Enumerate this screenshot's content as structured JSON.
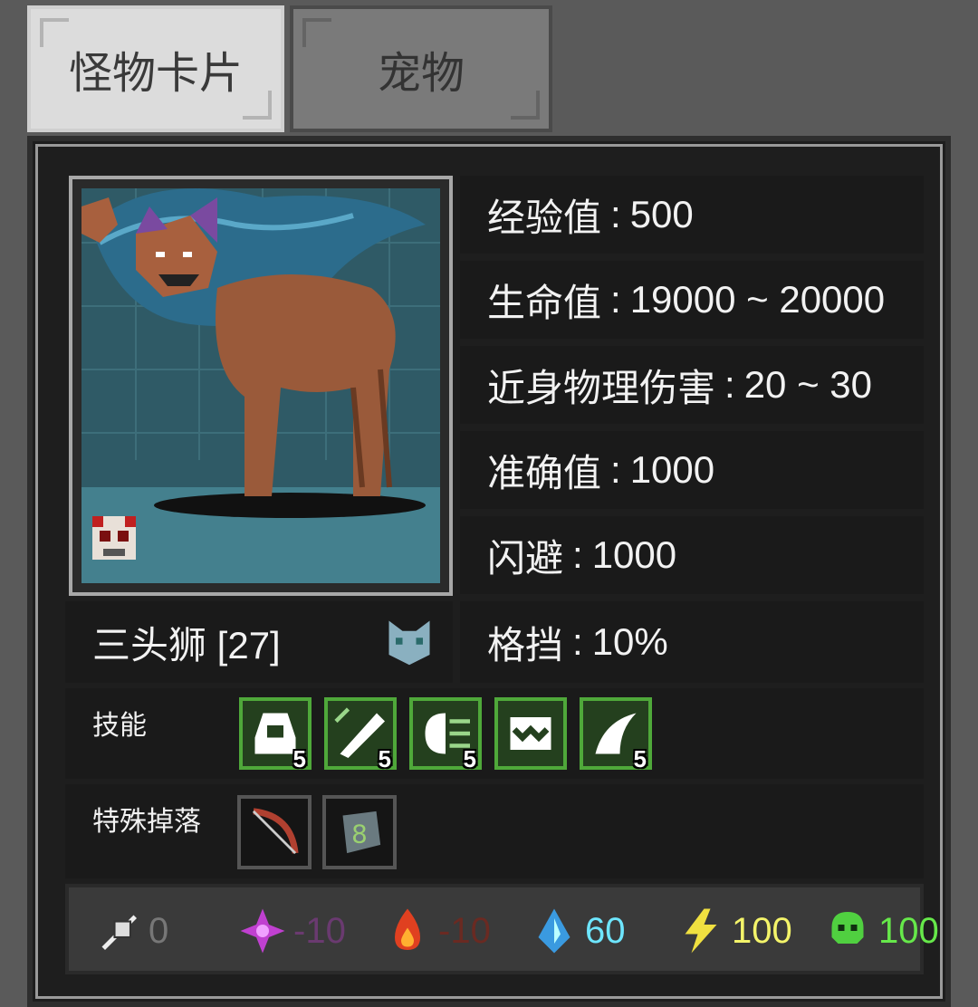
{
  "tabs": [
    {
      "label": "怪物卡片",
      "active": true
    },
    {
      "label": "宠物",
      "active": false
    }
  ],
  "monster": {
    "name": "三头狮 [27]"
  },
  "stats": [
    {
      "label": "经验值",
      "value": "500"
    },
    {
      "label": "生命值",
      "value": "19000 ~ 20000"
    },
    {
      "label": "近身物理伤害",
      "value": "20 ~ 30"
    },
    {
      "label": "准确值",
      "value": "1000"
    },
    {
      "label": "闪避",
      "value": "1000"
    },
    {
      "label": "格挡",
      "value": "10%"
    }
  ],
  "skills": {
    "label": "技能",
    "items": [
      {
        "icon": "hood-skill-icon",
        "level": "5"
      },
      {
        "icon": "sword-skill-icon",
        "level": "5"
      },
      {
        "icon": "roar-skill-icon",
        "level": "5"
      },
      {
        "icon": "bite-skill-icon",
        "level": ""
      },
      {
        "icon": "claw-skill-icon",
        "level": "5"
      }
    ]
  },
  "drops": {
    "label": "特殊掉落",
    "items": [
      {
        "icon": "bow-icon"
      },
      {
        "icon": "rune-stone-icon"
      }
    ]
  },
  "resistances": [
    {
      "icon": "physical-icon",
      "value": "0",
      "color": "#777777"
    },
    {
      "icon": "arcane-icon",
      "value": "-10",
      "color": "#6a3a70"
    },
    {
      "icon": "fire-icon",
      "value": "-10",
      "color": "#6a2a22"
    },
    {
      "icon": "water-icon",
      "value": "60",
      "color": "#6ee6ff"
    },
    {
      "icon": "lightning-icon",
      "value": "100",
      "color": "#f4f46a"
    },
    {
      "icon": "poison-icon",
      "value": "100",
      "color": "#66e84a"
    }
  ]
}
